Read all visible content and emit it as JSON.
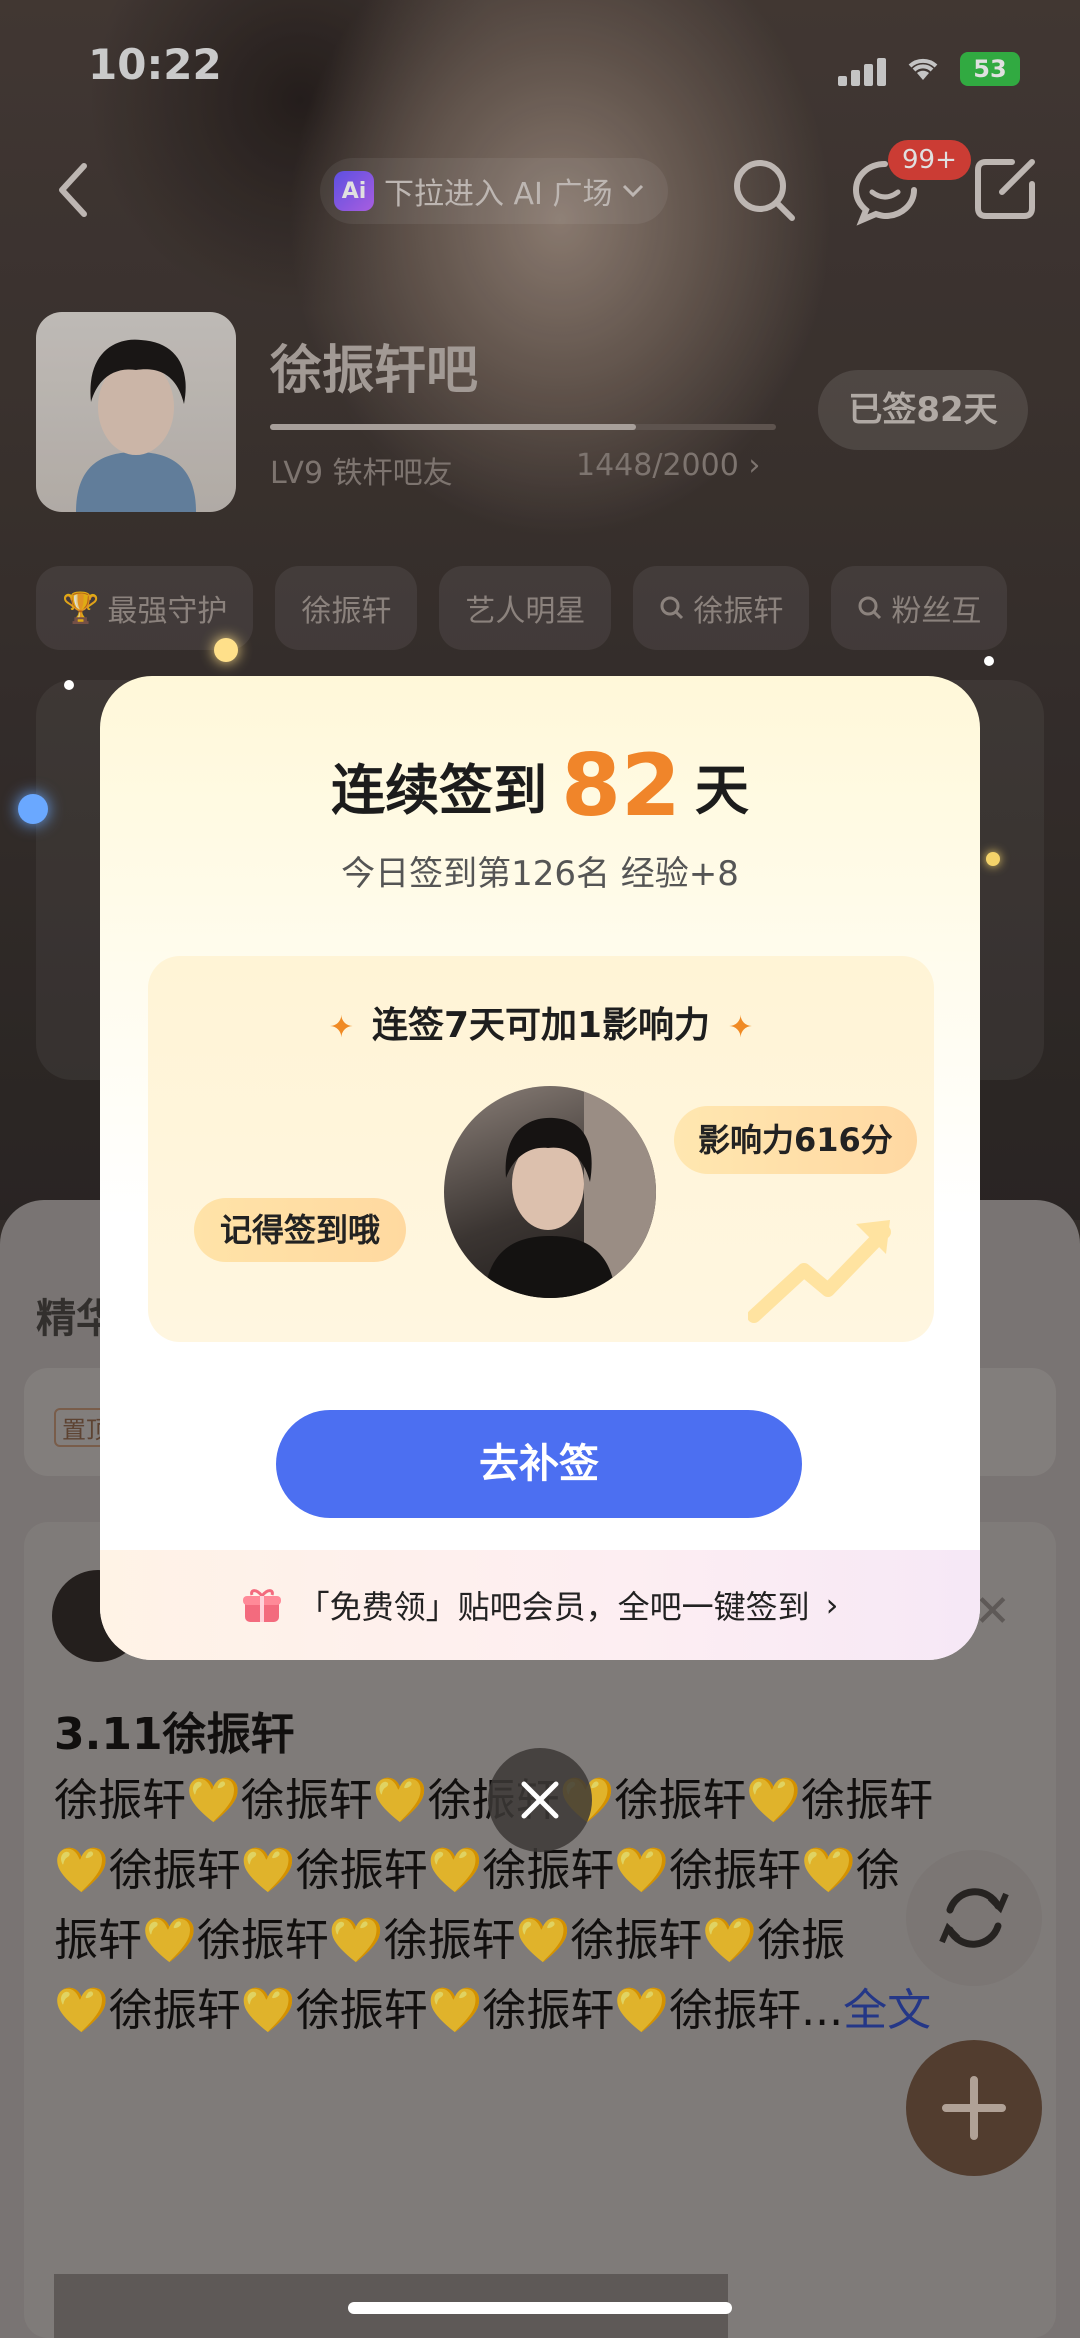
{
  "status_bar": {
    "time": "10:22",
    "battery": "53"
  },
  "top_nav": {
    "ai_chip_badge": "Ai",
    "ai_entry": "下拉进入 AI 广场",
    "message_badge": "99+"
  },
  "forum": {
    "name": "徐振轩吧",
    "level_label": "LV9 铁杆吧友",
    "exp_progress": "1448/2000",
    "exp_fraction": 0.724,
    "signed_button": "已签82天"
  },
  "tags": [
    "最强守护",
    "徐振轩",
    "艺人明星",
    "徐振轩",
    "粉丝互"
  ],
  "feed": {
    "tab_label": "精华",
    "pin_tag": "置顶",
    "post_title": "3.11徐振轩",
    "post_body_lines": [
      "徐振轩💛徐振轩💛徐振轩💛徐振轩💛徐振轩",
      "💛徐振轩💛徐振轩💛徐振轩💛徐振轩💛徐",
      "振轩💛徐振轩💛徐振轩💛徐振轩💛徐振",
      "💛徐振轩💛徐振轩💛徐振轩💛徐振轩..."
    ],
    "more_link": "全文"
  },
  "modal": {
    "title_prefix": "连续签到",
    "days": "82",
    "title_suffix": "天",
    "subtitle": "今日签到第126名 经验+8",
    "bonus_title": "连签7天可加1影响力",
    "star": "✦",
    "bubble_left": "记得签到哦",
    "bubble_right": "影响力616分",
    "cta": "去补签",
    "footer": "「免费领」贴吧会员，全吧一键签到",
    "footer_chevron": "›"
  },
  "colors": {
    "accent_blue": "#4c6ff1",
    "accent_orange": "#f0852a",
    "badge_red": "#e8453c"
  }
}
